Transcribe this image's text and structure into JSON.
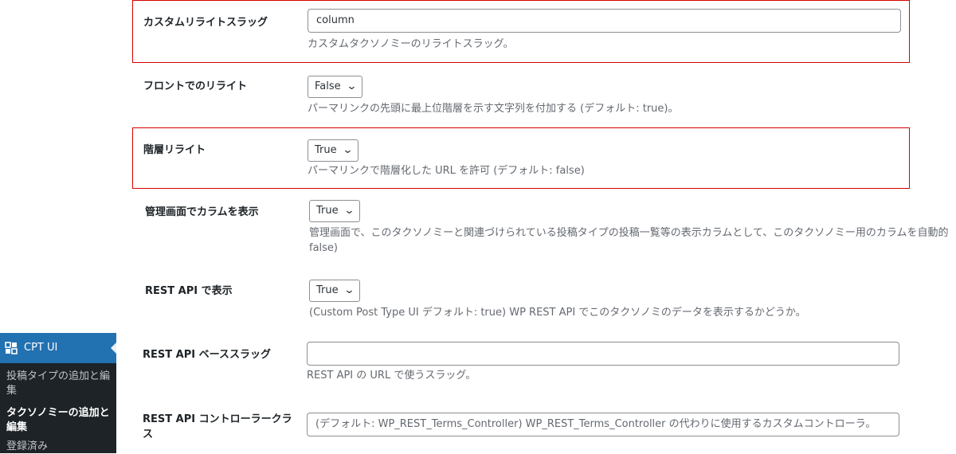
{
  "sidebar": {
    "menu_title": "CPT UI",
    "icon": "cpt-ui-grid-icon",
    "submenu": [
      "投稿タイプの追加と編集",
      "タクソノミーの追加と編集",
      "登録済み"
    ]
  },
  "rows": {
    "rewrite_slug": {
      "label": "カスタムリライトスラッグ",
      "value": "column",
      "description": "カスタムタクソノミーのリライトスラッグ。"
    },
    "rewrite_withfront": {
      "label": "フロントでのリライト",
      "value": "False",
      "description": "パーマリンクの先頭に最上位階層を示す文字列を付加する (デフォルト: true)。"
    },
    "rewrite_hierarchical": {
      "label": "階層リライト",
      "value": "True",
      "description": "パーマリンクで階層化した URL を許可 (デフォルト: false)"
    },
    "show_admin_column": {
      "label": "管理画面でカラムを表示",
      "value": "True",
      "description_line1": "管理画面で、このタクソノミーと関連づけられている投稿タイプの投稿一覧等の表示カラムとして、このタクソノミー用のカラムを自動的",
      "description_line2": "false)"
    },
    "show_in_rest": {
      "label": "REST API で表示",
      "value": "True",
      "description": "(Custom Post Type UI デフォルト: true) WP REST API でこのタクソノミのデータを表示するかどうか。"
    },
    "rest_base": {
      "label": "REST API ベーススラッグ",
      "value": "",
      "description": "REST API の URL で使うスラッグ。"
    },
    "rest_controller_class": {
      "label_line1": "REST API コントローラークラ",
      "label_line2": "ス",
      "placeholder": "(デフォルト: WP_REST_Terms_Controller) WP_REST_Terms_Controller の代わりに使用するカスタムコントローラ。"
    }
  },
  "colors": {
    "highlight": "#d80000",
    "admin_menu_bg": "#1d2327",
    "admin_menu_active": "#2271b1"
  }
}
